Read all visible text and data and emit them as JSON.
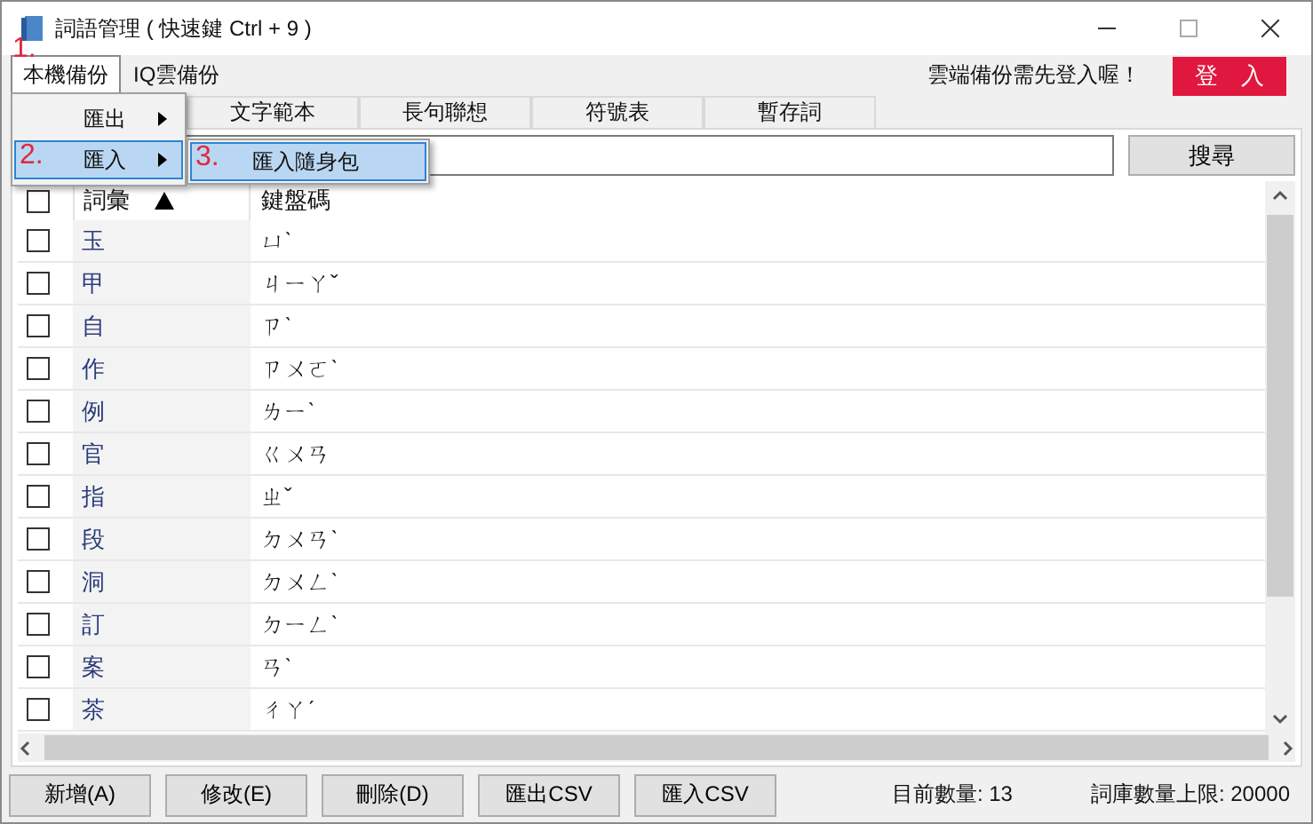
{
  "window": {
    "title": "詞語管理 ( 快速鍵 Ctrl + 9 )"
  },
  "menubar": [
    {
      "label": "本機備份",
      "open": true
    },
    {
      "label": "IQ雲備份",
      "open": false
    }
  ],
  "cloud_notice": "雲端備份需先登入喔！",
  "login_button": "登　入",
  "menu": [
    {
      "label": "匯出",
      "selected": false
    },
    {
      "label": "匯入",
      "selected": true
    }
  ],
  "submenu": [
    {
      "label": "匯入隨身包",
      "selected": true
    }
  ],
  "annotations": [
    {
      "label": "1."
    },
    {
      "label": "2."
    },
    {
      "label": "3."
    }
  ],
  "tabs": [
    {
      "label": "文字範本"
    },
    {
      "label": "長句聯想"
    },
    {
      "label": "符號表"
    },
    {
      "label": "暫存詞"
    }
  ],
  "search_button": "搜尋",
  "table": {
    "columns": [
      {
        "label": "詞彙",
        "sorted": true
      },
      {
        "label": "鍵盤碼",
        "sorted": false
      }
    ],
    "header_checked": false,
    "rows": [
      {
        "word": "玉",
        "code": "ㄩˋ",
        "checked": false
      },
      {
        "word": "甲",
        "code": "ㄐㄧㄚˇ",
        "checked": false
      },
      {
        "word": "自",
        "code": "ㄗˋ",
        "checked": false
      },
      {
        "word": "作",
        "code": "ㄗㄨㄛˋ",
        "checked": false
      },
      {
        "word": "例",
        "code": "ㄌㄧˋ",
        "checked": false
      },
      {
        "word": "官",
        "code": "ㄍㄨㄢ",
        "checked": false
      },
      {
        "word": "指",
        "code": "ㄓˇ",
        "checked": false
      },
      {
        "word": "段",
        "code": "ㄉㄨㄢˋ",
        "checked": false
      },
      {
        "word": "洞",
        "code": "ㄉㄨㄥˋ",
        "checked": false
      },
      {
        "word": "訂",
        "code": "ㄉㄧㄥˋ",
        "checked": false
      },
      {
        "word": "案",
        "code": "ㄢˋ",
        "checked": false
      },
      {
        "word": "茶",
        "code": "ㄔㄚˊ",
        "checked": false
      }
    ]
  },
  "buttons": [
    "新增(A)",
    "修改(E)",
    "刪除(D)",
    "匯出CSV",
    "匯入CSV"
  ],
  "status": [
    "目前數量: 13",
    "詞庫數量上限: 20000"
  ]
}
